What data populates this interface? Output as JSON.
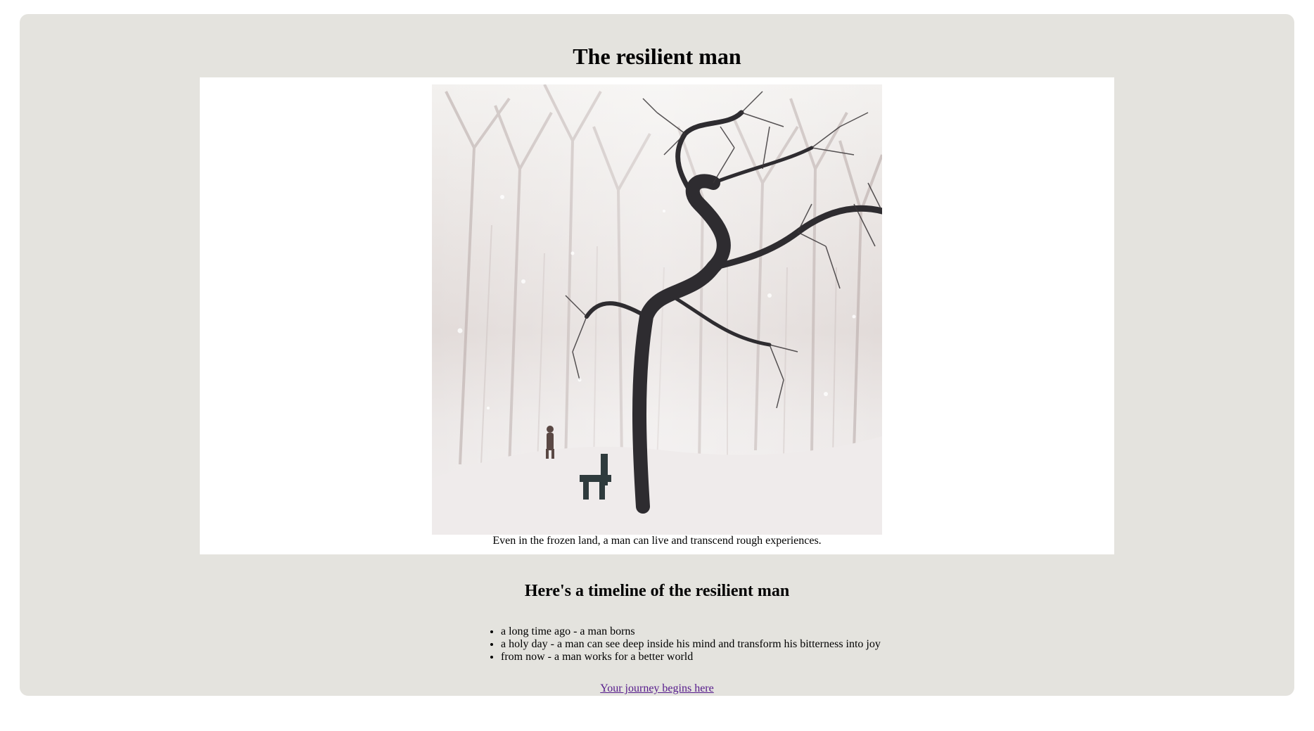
{
  "page": {
    "title": "The resilient man",
    "image": {
      "alt": "A snowy park with a twisted tree, a bench, and a man walking in the snow",
      "caption": "Even in the frozen land, a man can live and transcend rough experiences."
    },
    "timeline": {
      "heading": "Here's a timeline of the resilient man",
      "items": [
        "a long time ago - a man borns",
        "a holy day - a man can see deep inside his mind and transform his bitterness into joy",
        "from now - a man works for a better world"
      ]
    },
    "link": {
      "label": "Your journey begins here"
    }
  },
  "colors": {
    "main_background": "#e4e3de",
    "image_panel_background": "#ffffff",
    "visited_link": "#551a8b"
  }
}
